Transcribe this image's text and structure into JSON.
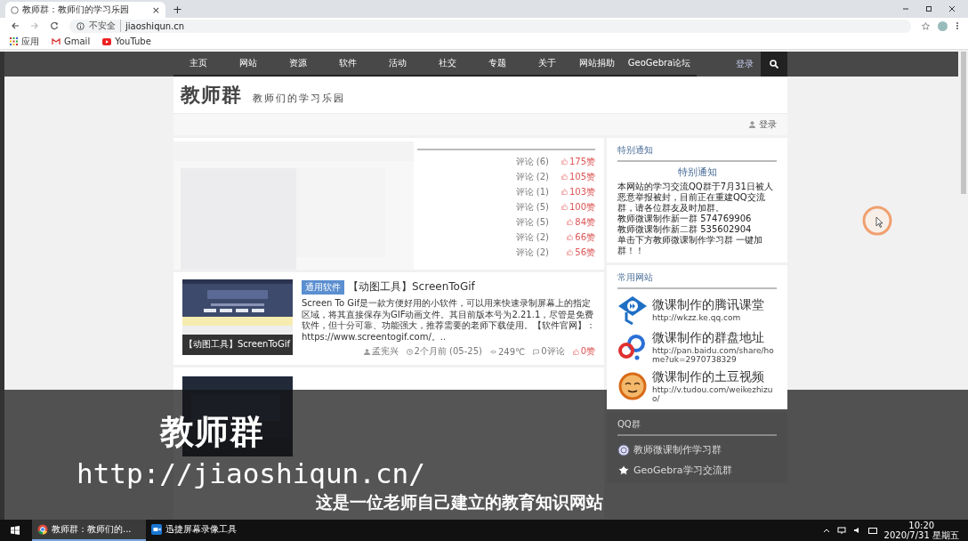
{
  "browser": {
    "tab_title": "教师群：教师们的学习乐园",
    "tab_close": "×",
    "new_tab": "+",
    "security": "不安全",
    "url": "jiaoshiqun.cn",
    "bookmarks": [
      {
        "label": "应用",
        "kind": "apps"
      },
      {
        "label": "Gmail",
        "kind": "gmail"
      },
      {
        "label": "YouTube",
        "kind": "youtube"
      }
    ]
  },
  "nav": {
    "items": [
      "主页",
      "网站",
      "资源",
      "软件",
      "活动",
      "社交",
      "专题",
      "关于",
      "网站捐助",
      "GeoGebra论坛"
    ],
    "login": "登录"
  },
  "header": {
    "logo": "教师群",
    "tagline": "教师们的学习乐园",
    "login": "登录"
  },
  "ranking": [
    {
      "comments": "评论 (6)",
      "likes": "175赞"
    },
    {
      "comments": "评论 (2)",
      "likes": "105赞"
    },
    {
      "comments": "评论 (1)",
      "likes": "103赞"
    },
    {
      "comments": "评论 (5)",
      "likes": "100赞"
    },
    {
      "comments": "评论 (5)",
      "likes": "84赞"
    },
    {
      "comments": "评论 (2)",
      "likes": "66赞"
    },
    {
      "comments": "评论 (2)",
      "likes": "56赞"
    }
  ],
  "articles": [
    {
      "thumb_caption": "【动图工具】ScreenToGif",
      "tag": "通用软件",
      "title": "【动图工具】ScreenToGif",
      "excerpt": "Screen To Gif是一款方便好用的小软件，可以用来快速录制屏幕上的指定区域，将其直接保存为GIF动画文件。其目前版本号为2.21.1，尽管是免费软件，但十分可靠、功能强大，推荐需要的老师下载使用。【软件官网】：https://www.screentogif.com/。..",
      "author": "孟宪兴",
      "time": "2个月前 (05-25)",
      "views": "249℃",
      "comments": "0评论",
      "likes": "0赞"
    }
  ],
  "sidebar": {
    "notice": {
      "heading": "特别通知",
      "title": "特别通知",
      "paragraphs": [
        "本网站的学习交流QQ群于7月31日被人恶意举报被封，目前正在重建QQ交流群，请各位群友及时加群。",
        "教师微课制作新一群 574769906",
        "教师微课制作新二群 535602904",
        "单击下方教师微课制作学习群 一键加群！！"
      ]
    },
    "links": {
      "heading": "常用网站",
      "items": [
        {
          "kind": "tencent",
          "title": "微课制作的腾讯课堂",
          "url": "http://wkzz.ke.qq.com"
        },
        {
          "kind": "baidu",
          "title": "微课制作的群盘地址",
          "url": "http://pan.baidu.com/share/home?uk=2970738329"
        },
        {
          "kind": "tudou",
          "title": "微课制作的土豆视频",
          "url": "http://v.tudou.com/weikezhizuo/"
        }
      ]
    },
    "qq": {
      "heading": "QQ群",
      "items": [
        "教师微课制作学习群",
        "GeoGebra学习交流群"
      ]
    }
  },
  "overlay": {
    "title": "教师群",
    "url": "http://jiaoshiqun.cn/",
    "subtitle": "这是一位老师自己建立的教育知识网站"
  },
  "taskbar": {
    "windows": [
      {
        "label": "教师群：教师们的...",
        "kind": "chrome",
        "selected": true
      },
      {
        "label": "迅捷屏幕录像工具",
        "kind": "recorder",
        "selected": false
      }
    ],
    "time": "10:20",
    "date": "2020/7/31 星期五"
  }
}
